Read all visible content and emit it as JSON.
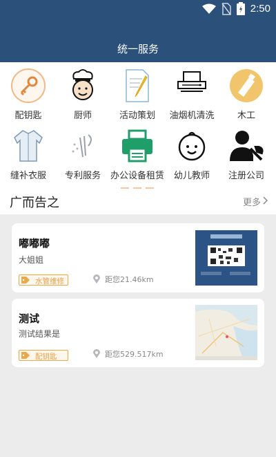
{
  "status": {
    "time": "2:50"
  },
  "header": {
    "title": "统一服务"
  },
  "services": [
    {
      "label": "配钥匙",
      "icon": "key-icon"
    },
    {
      "label": "厨师",
      "icon": "chef-icon"
    },
    {
      "label": "活动策划",
      "icon": "document-pen-icon"
    },
    {
      "label": "油烟机清洗",
      "icon": "range-hood-icon"
    },
    {
      "label": "木工",
      "icon": "saw-icon"
    },
    {
      "label": "缝补衣服",
      "icon": "shirt-icon"
    },
    {
      "label": "专利服务",
      "icon": "patent-icon"
    },
    {
      "label": "办公设备租赁",
      "icon": "printer-icon"
    },
    {
      "label": "幼儿教师",
      "icon": "baby-face-icon"
    },
    {
      "label": "注册公司",
      "icon": "user-wrench-icon"
    }
  ],
  "ads": {
    "title": "广而告之",
    "more": "更多"
  },
  "cards": [
    {
      "title": "嘟嘟嘟",
      "subtitle": "大姐姐",
      "tag": "水管维修",
      "distance": "距您21.46km",
      "image": "qr-code-image"
    },
    {
      "title": "测试",
      "subtitle": "测试结果是",
      "tag": "配钥匙",
      "distance": "距您529.517km",
      "image": "map-image"
    }
  ],
  "colors": {
    "header": "#2b5079",
    "accent": "#e8a94b",
    "printer": "#1f9e6a"
  }
}
